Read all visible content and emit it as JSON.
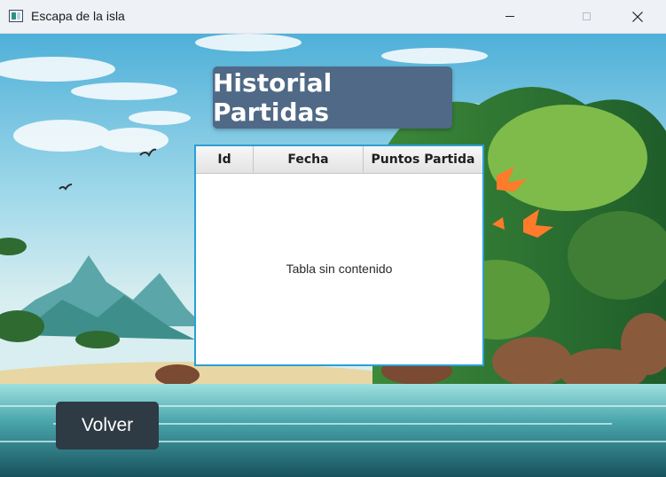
{
  "window": {
    "title": "Escapa de la isla",
    "icon": "app-window-icon",
    "controls": [
      "minimize-icon",
      "maximize-icon",
      "close-icon"
    ]
  },
  "heading": {
    "text": "Historial Partidas"
  },
  "table": {
    "columns": [
      "Id",
      "Fecha",
      "Puntos Partida"
    ],
    "rows": [],
    "placeholder": "Tabla sin contenido"
  },
  "actions": {
    "back_label": "Volver"
  },
  "colors": {
    "heading_bg": "#4f6986",
    "table_border": "#2a9fd6",
    "button_bg": "#2e3a44"
  }
}
